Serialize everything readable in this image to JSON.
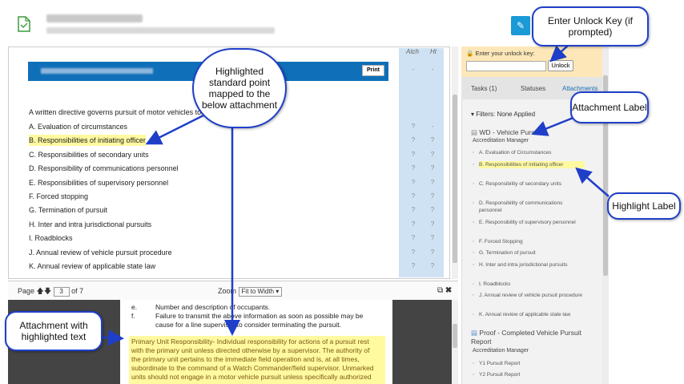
{
  "document": {
    "columns": {
      "attach": "Atch",
      "hit": "Ht"
    },
    "print_label": "Print",
    "intro": "A written directive governs pursuit of motor vehicles to",
    "rows": [
      {
        "text": "A. Evaluation of circumstances",
        "m1": "?",
        "m2": "-"
      },
      {
        "text": "B. Responsibilities of initiating officer",
        "m1": "?",
        "m2": "?"
      },
      {
        "text": "C. Responsibilities of secondary units",
        "m1": "?",
        "m2": "?"
      },
      {
        "text": "D. Responsibility of communications personnel",
        "m1": "?",
        "m2": "?"
      },
      {
        "text": "E. Responsibilities of supervisory personnel",
        "m1": "?",
        "m2": "?"
      },
      {
        "text": "F. Forced stopping",
        "m1": "?",
        "m2": "?"
      },
      {
        "text": "G. Termination of pursuit",
        "m1": "?",
        "m2": "?"
      },
      {
        "text": "H. Inter and intra jurisdictional pursuits",
        "m1": "?",
        "m2": "?"
      },
      {
        "text": "I. Roadblocks",
        "m1": "?",
        "m2": "?"
      },
      {
        "text": "J. Annual review of vehicle pursuit procedure",
        "m1": "?",
        "m2": "?"
      },
      {
        "text": "K. Annual review of applicable state law",
        "m1": "?",
        "m2": "?"
      }
    ],
    "header_marks": {
      "m1": "-",
      "m2": "-"
    }
  },
  "viewer": {
    "page_label": "Page",
    "page_value": "3",
    "page_total": "of 7",
    "zoom_label": "Zoom",
    "zoom_value": "Fit to Width",
    "lines": [
      {
        "num": "e.",
        "text": "Number and description of occupants."
      },
      {
        "num": "f.",
        "text": "Failure to transmit the above information as soon as possible may be"
      },
      {
        "num": "",
        "text": "cause for a line supervisor to consider terminating the pursuit."
      }
    ],
    "highlight_lines": [
      "Primary Unit Responsibility- Individual responsibility for actions of a pursuit rest",
      "with the primary unit unless directed otherwise by a supervisor. The authority of",
      "the primary unit pertains to the immediate field operation and is, at all times,",
      "subordinate to the command of a Watch Commander/field supervisor. Unmarked",
      "units should not engage in a motor vehicle pursuit unless specifically authorized"
    ]
  },
  "sidebar": {
    "unlock_label": "Enter your unlock key:",
    "unlock_button": "Unlock",
    "tabs": [
      "Tasks (1)",
      "Statuses",
      "Attachments"
    ],
    "filters": "Filters: None Applied",
    "attachments": [
      {
        "title": "WD - Vehicle Pursuit",
        "sub": "Accreditation Manager",
        "items": [
          "A. Evaluation of Circumstances",
          "B. Responsibilities of initiating officer",
          "C. Responsibility of secondary units",
          "D. Responsibility of communications personnel",
          "E. Responsibility of supervisory personnel",
          "F. Forced Stopping",
          "G. Termination of pursuit",
          "H. Inter and intra jurisdictional pursuits",
          "I. Roadblocks",
          "J. Annual review of vehicle pursuit procedure",
          "K. Annual review of applicable state law"
        ]
      },
      {
        "title": "Proof - Completed Vehicle Pursuit Report",
        "sub": "Accreditation Manager",
        "items": [
          "Y1 Pursuit Report",
          "Y2 Pursuit Report"
        ]
      }
    ]
  },
  "callouts": {
    "unlock": "Enter Unlock Key (if prompted)",
    "standard": "Highlighted standard point mapped to the below attachment",
    "attachment_label": "Attachment Label",
    "highlight_label": "Highlight Label",
    "attachment_text": "Attachment with highlighted text"
  },
  "colors": {
    "accent": "#1a9ad6",
    "highlight": "#fff9a0",
    "callout_border": "#1f3fc8",
    "title_bar": "#0f6fb8"
  }
}
